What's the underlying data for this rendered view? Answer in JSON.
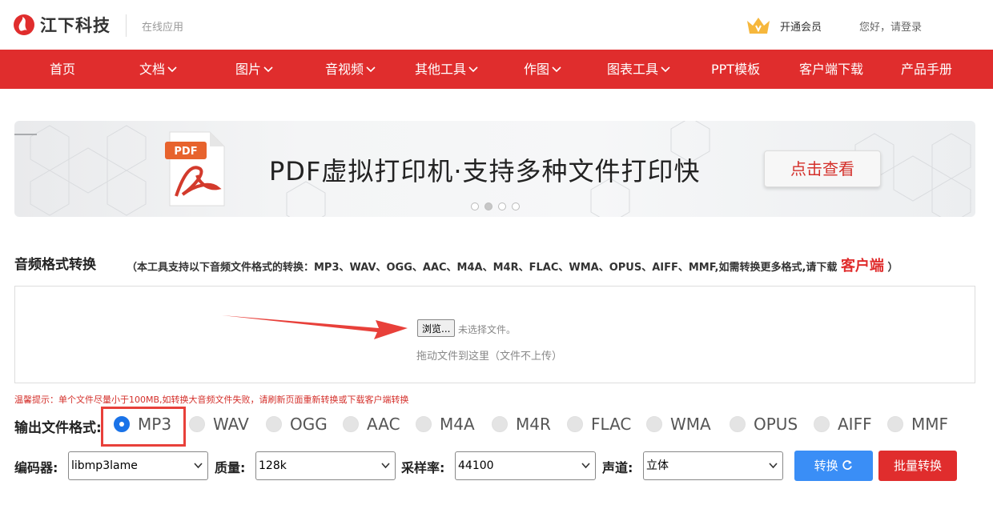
{
  "header": {
    "brand": "江下科技",
    "subtitle": "在线应用",
    "vip_label": "开通会员",
    "login_label": "您好，请登录"
  },
  "nav": {
    "items": [
      {
        "label": "首页",
        "dropdown": false
      },
      {
        "label": "文档",
        "dropdown": true
      },
      {
        "label": "图片",
        "dropdown": true
      },
      {
        "label": "音视频",
        "dropdown": true
      },
      {
        "label": "其他工具",
        "dropdown": true
      },
      {
        "label": "作图",
        "dropdown": true
      },
      {
        "label": "图表工具",
        "dropdown": true
      },
      {
        "label": "PPT模板",
        "dropdown": false
      },
      {
        "label": "客户端下载",
        "dropdown": false
      },
      {
        "label": "产品手册",
        "dropdown": false
      }
    ]
  },
  "banner": {
    "icon_label": "PDF",
    "headline": "PDF虚拟打印机·支持多种文件打印快",
    "button": "点击查看",
    "active_slide": 2,
    "slide_count": 4
  },
  "tool": {
    "title": "音频格式转换",
    "desc_prefix": "（本工具支持以下音频文件格式的转换：MP3、WAV、OGG、AAC、M4A、M4R、FLAC、WMA、OPUS、AIFF、MMF,如需转换更多格式,请下载",
    "desc_link": "客户端",
    "desc_suffix": "）"
  },
  "upload": {
    "browse": "浏览...",
    "no_file": "未选择文件。",
    "drag_hint": "拖动文件到这里（文件不上传）"
  },
  "tip": "温馨提示：单个文件尽量小于100MB,如转换大音频文件失败，请刷新页面重新转换或下载客户端转换",
  "format": {
    "label": "输出文件格式:",
    "selected": "MP3",
    "options": [
      "MP3",
      "WAV",
      "OGG",
      "AAC",
      "M4A",
      "M4R",
      "FLAC",
      "WMA",
      "OPUS",
      "AIFF",
      "MMF"
    ]
  },
  "settings": {
    "encoder_label": "编码器:",
    "encoder_value": "libmp3lame",
    "quality_label": "质量:",
    "quality_value": "128k",
    "samplerate_label": "采样率:",
    "samplerate_value": "44100",
    "channel_label": "声道:",
    "channel_value": "立体",
    "convert_button": "转换",
    "batch_button": "批量转换"
  },
  "colors": {
    "brand_red": "#e02d2d",
    "accent_blue": "#3a8ef6",
    "highlight": "#e8403a"
  }
}
